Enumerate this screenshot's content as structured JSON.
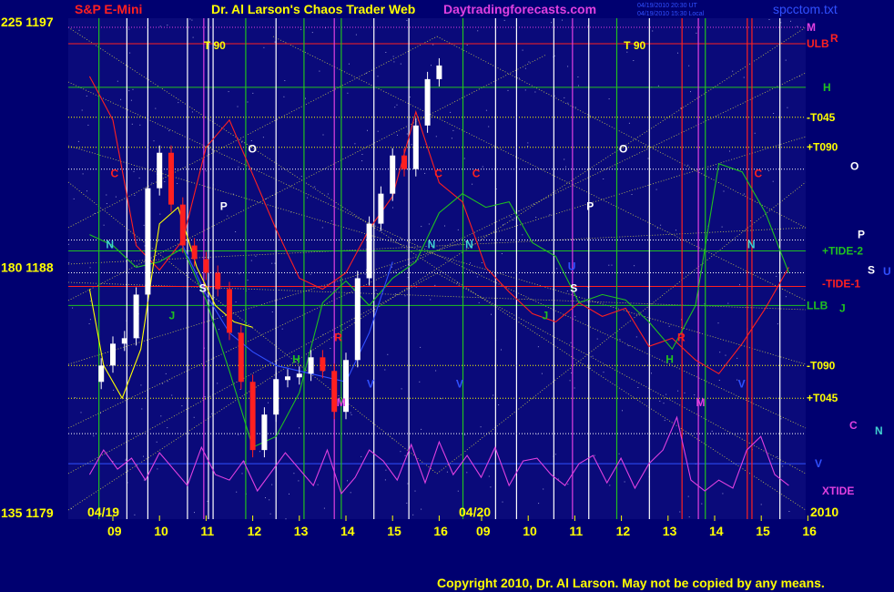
{
  "header": {
    "left_price": "225  1197",
    "symbol": "S&P E-Mini",
    "title": "Dr. Al Larson's Chaos Trader Web",
    "site": "Daytradingforecasts.com",
    "timestamp_1": "04/19/2010 20:30 UT",
    "timestamp_2": "04/19/2010 15:30 Local",
    "file": "spcctom.txt"
  },
  "footer": {
    "copyright": "Copyright 2010, Dr. Al Larson. May not be copied by any means."
  },
  "colors": {
    "background": "#000070",
    "plot": "#0A0A7A",
    "yellow": "#FFFF00",
    "red": "#FF2020",
    "green": "#20C020",
    "magenta": "#E040E0",
    "white": "#FFFFFF",
    "cyan": "#40D0D0",
    "blue": "#3050FF"
  },
  "chart_data": {
    "type": "line",
    "title": "S&P E-Mini",
    "y_axis_labels": [
      {
        "text": "225  1197",
        "value": 1197
      },
      {
        "text": "180  1188",
        "value": 1188
      },
      {
        "text": "135  1179",
        "value": 1179
      }
    ],
    "ylim": [
      1179,
      1197
    ],
    "date_labels": [
      "04/19",
      "04/20",
      "2010"
    ],
    "x_ticks": [
      "09",
      "10",
      "11",
      "12",
      "13",
      "14",
      "15",
      "16",
      "09",
      "10",
      "11",
      "12",
      "13",
      "14",
      "15",
      "16"
    ],
    "right_labels": [
      {
        "text": "M",
        "color": "magenta",
        "value": 1196.8
      },
      {
        "text": "ULB",
        "color": "red",
        "value": 1196.2
      },
      {
        "text": "R",
        "color": "red",
        "value": 1196.4
      },
      {
        "text": "H",
        "color": "green",
        "value": 1194.6
      },
      {
        "text": "-T045",
        "color": "yellow",
        "value": 1193.5
      },
      {
        "text": "+T090",
        "color": "yellow",
        "value": 1192.4
      },
      {
        "text": "O",
        "color": "white",
        "value": 1191.7
      },
      {
        "text": "P",
        "color": "white",
        "value": 1189.2
      },
      {
        "text": "+TIDE-2",
        "color": "green",
        "value": 1188.6
      },
      {
        "text": "S",
        "color": "white",
        "value": 1187.9
      },
      {
        "text": "U",
        "color": "blue",
        "value": 1187.85
      },
      {
        "text": "-TIDE-1",
        "color": "red",
        "value": 1187.4
      },
      {
        "text": "LLB",
        "color": "green",
        "value": 1186.6
      },
      {
        "text": "J",
        "color": "green",
        "value": 1186.5
      },
      {
        "text": "-T090",
        "color": "yellow",
        "value": 1184.4
      },
      {
        "text": "+T045",
        "color": "yellow",
        "value": 1183.2
      },
      {
        "text": "C",
        "color": "magenta",
        "value": 1182.2
      },
      {
        "text": "N",
        "color": "cyan",
        "value": 1182.0
      },
      {
        "text": "V",
        "color": "blue",
        "value": 1180.8
      },
      {
        "text": "XTIDE",
        "color": "magenta",
        "value": 1179.8
      }
    ],
    "plot_letters": [
      {
        "text": "T  90",
        "color": "yellow",
        "session": 0,
        "hour": 10.95,
        "value": 1196.0
      },
      {
        "text": "T  90",
        "color": "yellow",
        "session": 1,
        "hour": 12.05,
        "value": 1196.0
      },
      {
        "text": "O",
        "color": "white",
        "session": 0,
        "hour": 11.9,
        "value": 1192.2
      },
      {
        "text": "O",
        "color": "white",
        "session": 1,
        "hour": 11.95,
        "value": 1192.2
      },
      {
        "text": "C",
        "color": "red",
        "session": 0,
        "hour": 8.95,
        "value": 1191.3
      },
      {
        "text": "C",
        "color": "red",
        "session": 0,
        "hour": 15.9,
        "value": 1191.3
      },
      {
        "text": "C",
        "color": "red",
        "session": 1,
        "hour": 8.8,
        "value": 1191.3
      },
      {
        "text": "C",
        "color": "red",
        "session": 1,
        "hour": 14.85,
        "value": 1191.3
      },
      {
        "text": "P",
        "color": "white",
        "session": 0,
        "hour": 11.3,
        "value": 1190.1
      },
      {
        "text": "P",
        "color": "white",
        "session": 1,
        "hour": 11.25,
        "value": 1190.1
      },
      {
        "text": "N",
        "color": "cyan",
        "session": 0,
        "hour": 8.85,
        "value": 1188.7
      },
      {
        "text": "N",
        "color": "cyan",
        "session": 0,
        "hour": 15.75,
        "value": 1188.7
      },
      {
        "text": "N",
        "color": "cyan",
        "session": 1,
        "hour": 8.65,
        "value": 1188.7
      },
      {
        "text": "N",
        "color": "cyan",
        "session": 1,
        "hour": 14.7,
        "value": 1188.7
      },
      {
        "text": "S",
        "color": "white",
        "session": 0,
        "hour": 10.85,
        "value": 1187.1
      },
      {
        "text": "S",
        "color": "white",
        "session": 1,
        "hour": 10.9,
        "value": 1187.1
      },
      {
        "text": "U",
        "color": "blue",
        "session": 1,
        "hour": 10.85,
        "value": 1187.9
      },
      {
        "text": "J",
        "color": "green",
        "session": 0,
        "hour": 10.2,
        "value": 1186.1
      },
      {
        "text": "J",
        "color": "green",
        "session": 1,
        "hour": 10.3,
        "value": 1186.1
      },
      {
        "text": "R",
        "color": "red",
        "session": 0,
        "hour": 13.75,
        "value": 1185.3
      },
      {
        "text": "R",
        "color": "red",
        "session": 1,
        "hour": 13.2,
        "value": 1185.3
      },
      {
        "text": "H",
        "color": "green",
        "session": 0,
        "hour": 12.85,
        "value": 1184.5
      },
      {
        "text": "H",
        "color": "green",
        "session": 1,
        "hour": 12.95,
        "value": 1184.5
      },
      {
        "text": "V",
        "color": "blue",
        "session": 0,
        "hour": 14.45,
        "value": 1183.6
      },
      {
        "text": "V",
        "color": "blue",
        "session": 1,
        "hour": 8.45,
        "value": 1183.6
      },
      {
        "text": "V",
        "color": "blue",
        "session": 1,
        "hour": 14.5,
        "value": 1183.6
      },
      {
        "text": "M",
        "color": "magenta",
        "session": 0,
        "hour": 13.8,
        "value": 1182.9
      },
      {
        "text": "M",
        "color": "magenta",
        "session": 1,
        "hour": 13.6,
        "value": 1182.9
      }
    ],
    "vertical_lines": [
      {
        "session": 0,
        "hour": 8.7,
        "color": "green"
      },
      {
        "session": 0,
        "hour": 9.3,
        "color": "white"
      },
      {
        "session": 0,
        "hour": 9.75,
        "color": "white"
      },
      {
        "session": 0,
        "hour": 10.6,
        "color": "white"
      },
      {
        "session": 0,
        "hour": 10.95,
        "color": "magenta"
      },
      {
        "session": 0,
        "hour": 11.05,
        "color": "white"
      },
      {
        "session": 0,
        "hour": 11.15,
        "color": "white"
      },
      {
        "session": 0,
        "hour": 11.85,
        "color": "green"
      },
      {
        "session": 0,
        "hour": 12.5,
        "color": "white"
      },
      {
        "session": 0,
        "hour": 13.1,
        "color": "green"
      },
      {
        "session": 0,
        "hour": 13.75,
        "color": "magenta"
      },
      {
        "session": 0,
        "hour": 13.9,
        "color": "green"
      },
      {
        "session": 0,
        "hour": 14.6,
        "color": "white"
      },
      {
        "session": 0,
        "hour": 15.35,
        "color": "white"
      },
      {
        "session": 1,
        "hour": 8.6,
        "color": "green"
      },
      {
        "session": 1,
        "hour": 9.3,
        "color": "white"
      },
      {
        "session": 1,
        "hour": 9.75,
        "color": "white"
      },
      {
        "session": 1,
        "hour": 10.55,
        "color": "white"
      },
      {
        "session": 1,
        "hour": 10.95,
        "color": "magenta"
      },
      {
        "session": 1,
        "hour": 11.3,
        "color": "white"
      },
      {
        "session": 1,
        "hour": 11.9,
        "color": "green"
      },
      {
        "session": 1,
        "hour": 12.6,
        "color": "white"
      },
      {
        "session": 1,
        "hour": 13.3,
        "color": "red"
      },
      {
        "session": 1,
        "hour": 13.65,
        "color": "magenta"
      },
      {
        "session": 1,
        "hour": 13.8,
        "color": "green"
      },
      {
        "session": 1,
        "hour": 14.7,
        "color": "red"
      },
      {
        "session": 1,
        "hour": 14.8,
        "color": "red"
      },
      {
        "session": 1,
        "hour": 15.4,
        "color": "white"
      }
    ],
    "horizontal_levels": [
      {
        "value": 1196.8,
        "color": "magenta",
        "style": "dotted"
      },
      {
        "value": 1196.2,
        "color": "red",
        "style": "solid"
      },
      {
        "value": 1194.6,
        "color": "green",
        "style": "solid"
      },
      {
        "value": 1193.5,
        "color": "yellow",
        "style": "dotted"
      },
      {
        "value": 1192.4,
        "color": "yellow",
        "style": "dotted"
      },
      {
        "value": 1191.6,
        "color": "white",
        "style": "dotted"
      },
      {
        "value": 1189.0,
        "color": "white",
        "style": "dotted"
      },
      {
        "value": 1188.6,
        "color": "green",
        "style": "solid"
      },
      {
        "value": 1187.8,
        "color": "white",
        "style": "dotted"
      },
      {
        "value": 1187.3,
        "color": "red",
        "style": "solid"
      },
      {
        "value": 1186.6,
        "color": "green",
        "style": "solid"
      },
      {
        "value": 1184.4,
        "color": "yellow",
        "style": "dotted"
      },
      {
        "value": 1183.2,
        "color": "yellow",
        "style": "dotted"
      },
      {
        "value": 1181.9,
        "color": "white",
        "style": "dotted"
      },
      {
        "value": 1180.8,
        "color": "blue",
        "style": "solid"
      }
    ],
    "price": {
      "name": "S&P E-Mini",
      "hours": [
        8.5,
        8.75,
        9.0,
        9.25,
        9.5,
        9.75,
        10.0,
        10.25,
        10.5,
        10.75,
        11.0,
        11.25,
        11.5,
        11.75,
        12.0,
        12.25,
        12.5,
        12.75,
        13.0,
        13.25,
        13.5,
        13.75,
        14.0,
        14.25,
        14.5,
        14.75,
        15.0,
        15.25,
        15.5,
        15.75,
        16.0
      ],
      "values": [
        1183.8,
        1184.4,
        1185.2,
        1185.4,
        1187.0,
        1190.9,
        1192.2,
        1190.3,
        1188.8,
        1188.3,
        1187.8,
        1187.2,
        1185.6,
        1183.8,
        1181.3,
        1182.6,
        1183.9,
        1184.0,
        1184.1,
        1184.7,
        1184.2,
        1182.7,
        1184.6,
        1187.6,
        1189.6,
        1190.7,
        1192.1,
        1191.6,
        1193.2,
        1194.9,
        1195.4
      ],
      "bar_color_up": "white",
      "bar_color_down": "red"
    },
    "indicators": [
      {
        "name": "red curve",
        "color": "red",
        "session": 0,
        "hours": [
          8.5,
          9.0,
          9.5,
          10.0,
          10.5,
          11.0,
          11.5,
          12.0,
          12.5,
          13.0,
          13.5,
          14.0,
          14.5,
          15.0,
          15.5,
          16.0,
          16.5,
          17.0,
          17.5,
          18.0,
          18.5,
          19.0,
          19.5,
          20.0,
          20.5,
          21.0,
          21.5,
          22.0,
          22.5,
          23.0,
          23.5
        ],
        "values": [
          1195.0,
          1193.4,
          1188.8,
          1187.9,
          1189.0,
          1192.4,
          1193.4,
          1191.4,
          1189.4,
          1187.6,
          1187.2,
          1187.8,
          1189.4,
          1190.6,
          1193.7,
          1191.1,
          1190.4,
          1188.0,
          1187.1,
          1186.3,
          1186.0,
          1186.7,
          1186.2,
          1186.5,
          1185.1,
          1185.4,
          1184.6,
          1184.1,
          1185.2,
          1186.5,
          1188.0
        ]
      },
      {
        "name": "green curve",
        "color": "green",
        "session": 0,
        "hours": [
          8.5,
          9.0,
          9.5,
          10.0,
          10.5,
          11.0,
          11.5,
          12.0,
          12.5,
          13.0,
          13.5,
          14.0,
          14.5,
          15.0,
          15.5,
          16.0,
          16.5,
          17.0,
          17.5,
          18.0,
          18.5,
          19.0,
          19.5,
          20.0,
          20.5,
          21.0,
          21.5,
          22.0,
          22.5,
          23.0,
          23.5
        ],
        "values": [
          1189.2,
          1188.8,
          1188.0,
          1188.2,
          1188.7,
          1186.8,
          1184.2,
          1181.4,
          1181.8,
          1183.4,
          1186.7,
          1187.5,
          1186.6,
          1187.6,
          1188.2,
          1190.0,
          1190.7,
          1190.2,
          1190.4,
          1188.9,
          1188.4,
          1186.7,
          1187.0,
          1186.8,
          1186.0,
          1185.0,
          1186.6,
          1191.8,
          1191.5,
          1190.0,
          1187.8
        ]
      },
      {
        "name": "blue curve",
        "color": "blue",
        "session": 0,
        "hours": [
          10.5,
          11.0,
          11.5,
          12.0,
          12.5,
          13.0,
          13.5,
          14.0,
          14.5,
          15.0
        ],
        "values": [
          1188.8,
          1187.0,
          1185.6,
          1184.9,
          1184.4,
          1184.2,
          1184.0,
          1183.8,
          1185.6,
          1188.2
        ]
      },
      {
        "name": "yellow curve",
        "color": "yellow",
        "session": 0,
        "hours": [
          8.5,
          8.8,
          9.2,
          9.6,
          10.0,
          10.4,
          10.8,
          11.2,
          11.6,
          12.0
        ],
        "values": [
          1187.2,
          1184.4,
          1183.2,
          1185.0,
          1189.6,
          1190.2,
          1188.0,
          1186.6,
          1186.0,
          1185.8
        ]
      },
      {
        "name": "xtide",
        "color": "magenta",
        "session": 0,
        "hours": [
          8.5,
          8.8,
          9.1,
          9.4,
          9.7,
          10.0,
          10.3,
          10.6,
          10.9,
          11.2,
          11.5,
          11.8,
          12.1,
          12.4,
          12.7,
          13.0,
          13.3,
          13.6,
          13.9,
          14.2,
          14.5,
          14.8,
          15.1,
          15.4,
          15.7,
          16.0,
          16.3,
          16.6,
          16.9,
          17.2,
          17.5,
          17.8,
          18.1,
          18.4,
          18.7,
          19.0,
          19.3,
          19.6,
          19.9,
          20.2,
          20.5,
          20.8,
          21.1,
          21.4,
          21.7,
          22.0,
          22.3,
          22.6,
          22.9,
          23.2,
          23.5
        ],
        "values": [
          1180.4,
          1181.3,
          1180.6,
          1181.0,
          1180.2,
          1181.2,
          1180.6,
          1180.0,
          1181.4,
          1180.4,
          1180.2,
          1180.9,
          1179.8,
          1180.5,
          1181.2,
          1180.6,
          1180.0,
          1181.3,
          1179.7,
          1180.3,
          1181.3,
          1180.9,
          1180.2,
          1181.5,
          1180.1,
          1181.6,
          1180.4,
          1181.1,
          1180.3,
          1181.4,
          1180.0,
          1180.9,
          1181.0,
          1180.4,
          1180.0,
          1180.8,
          1181.1,
          1180.1,
          1181.0,
          1179.9,
          1180.8,
          1181.3,
          1182.5,
          1180.2,
          1179.8,
          1180.2,
          1179.9,
          1181.3,
          1181.8,
          1180.4,
          1180.0
        ]
      }
    ]
  }
}
